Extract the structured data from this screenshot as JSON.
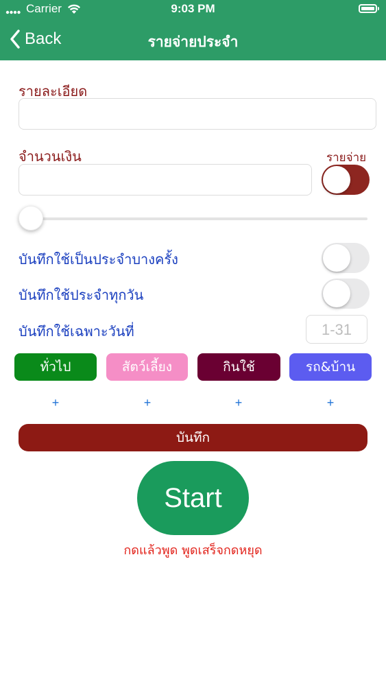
{
  "status": {
    "carrier": "Carrier",
    "time": "9:03 PM"
  },
  "nav": {
    "back_label": "Back",
    "title": "รายจ่ายประจำ"
  },
  "form": {
    "detail_label": "รายละเอียด",
    "detail_value": "",
    "amount_label": "จำนวนเงิน",
    "amount_value": "",
    "type_toggle_label": "รายจ่าย",
    "type_toggle_on": true,
    "slider_value": 0
  },
  "options": {
    "sometimes_label": "บันทึกใช้เป็นประจำบางครั้ง",
    "sometimes_on": false,
    "daily_label": "บันทึกใช้ประจำทุกวัน",
    "daily_on": false,
    "specific_day_label": "บันทึกใช้เฉพาะวันที่",
    "day_placeholder": "1-31"
  },
  "categories": [
    {
      "label": "ทั่วไป",
      "color": "#0a8a1a"
    },
    {
      "label": "สัตว์เลี้ยง",
      "color": "#f58ec6"
    },
    {
      "label": "กินใช้",
      "color": "#6a0032"
    },
    {
      "label": "รถ&บ้าน",
      "color": "#5c5cf0"
    }
  ],
  "add_symbol": "+",
  "save_label": "บันทึก",
  "voice": {
    "start_label": "Start",
    "hint": "กดแล้วพูด พูดเสร็จกดหยุด"
  },
  "colors": {
    "accent": "#2d9c67",
    "save": "#8d1a14",
    "start": "#1a9b5c",
    "label_dark": "#8a1a1a",
    "label_blue": "#1a3fbf",
    "hint": "#e2241c"
  }
}
